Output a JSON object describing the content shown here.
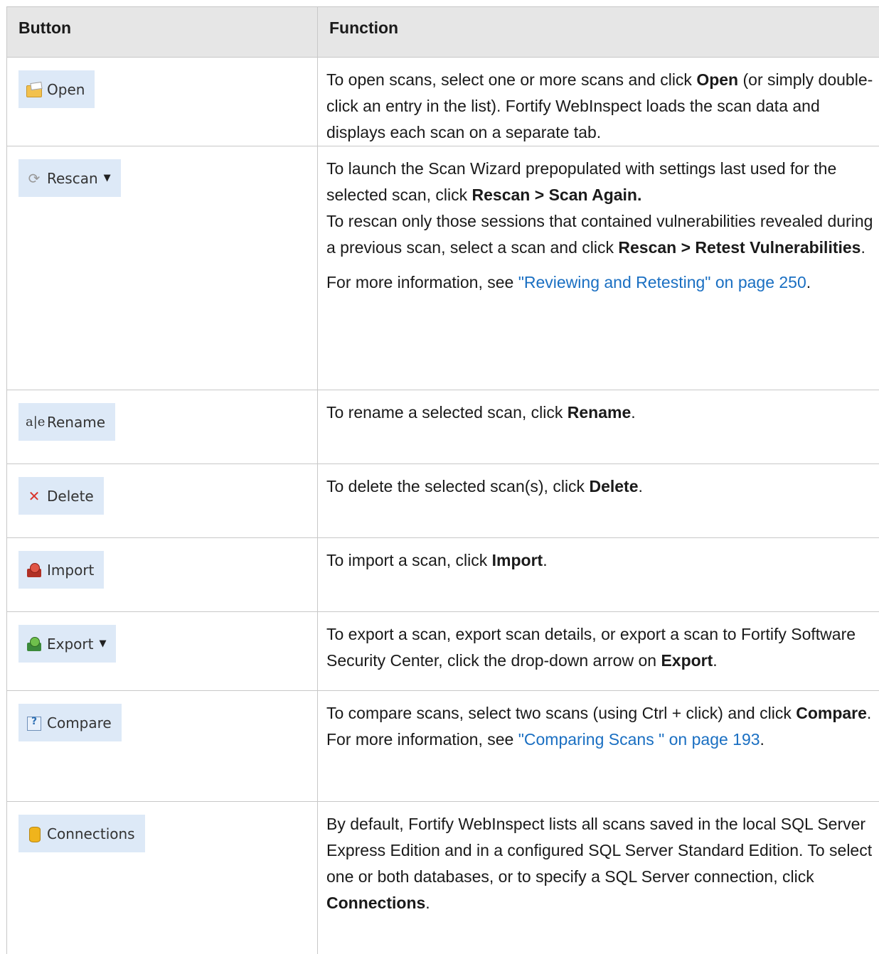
{
  "header": {
    "col_button": "Button",
    "col_function": "Function"
  },
  "rows": [
    {
      "button": {
        "label": "Open",
        "icon": "open-folder-icon"
      },
      "function": {
        "p1_a": "To open scans, select one or more scans and click ",
        "p1_b": "Open",
        "p1_c": " (or simply double-click an entry in the list). Fortify WebInspect loads the scan data and displays each scan on a separate tab."
      }
    },
    {
      "button": {
        "label": "Rescan",
        "icon": "rescan-icon",
        "caret": "▼"
      },
      "function": {
        "p1_a": "To launch the Scan Wizard prepopulated with settings last used for the selected scan, click ",
        "p1_b": "Rescan > Scan Again.",
        "p2_a": "To rescan only those sessions that contained vulnerabilities revealed during a previous scan, select a scan and click ",
        "p2_b": "Rescan > Retest Vulnerabilities",
        "p2_c": ".",
        "p3_a": "For more information, see ",
        "p3_link": "\"Reviewing and Retesting\" on page 250",
        "p3_c": "."
      }
    },
    {
      "button": {
        "label": "Rename",
        "icon": "rename-icon"
      },
      "function": {
        "p1_a": "To rename a selected scan, click ",
        "p1_b": "Rename",
        "p1_c": "."
      }
    },
    {
      "button": {
        "label": "Delete",
        "icon": "delete-x-icon"
      },
      "function": {
        "p1_a": "To delete the selected scan(s), click ",
        "p1_b": "Delete",
        "p1_c": "."
      }
    },
    {
      "button": {
        "label": "Import",
        "icon": "import-icon"
      },
      "function": {
        "p1_a": "To import a scan, click ",
        "p1_b": "Import",
        "p1_c": "."
      }
    },
    {
      "button": {
        "label": "Export",
        "icon": "export-icon",
        "caret": "▼"
      },
      "function": {
        "p1_a": "To export a scan, export scan details, or export a scan to Fortify Software Security Center, click the drop-down arrow on ",
        "p1_b": "Export",
        "p1_c": "."
      }
    },
    {
      "button": {
        "label": "Compare",
        "icon": "compare-icon"
      },
      "function": {
        "p1_a": "To compare scans, select two scans (using Ctrl + click) and click ",
        "p1_b": "Compare",
        "p1_c": ". For more information, see ",
        "p1_link": "\"Comparing Scans \" on page 193",
        "p1_d": "."
      }
    },
    {
      "button": {
        "label": "Connections",
        "icon": "database-icon"
      },
      "function": {
        "p1_a": "By default, Fortify WebInspect lists all scans saved in the local SQL Server Express Edition and in a configured SQL Server Standard Edition. To select one or both databases, or to specify a SQL Server connection, click ",
        "p1_b": "Connections",
        "p1_c": "."
      }
    }
  ]
}
